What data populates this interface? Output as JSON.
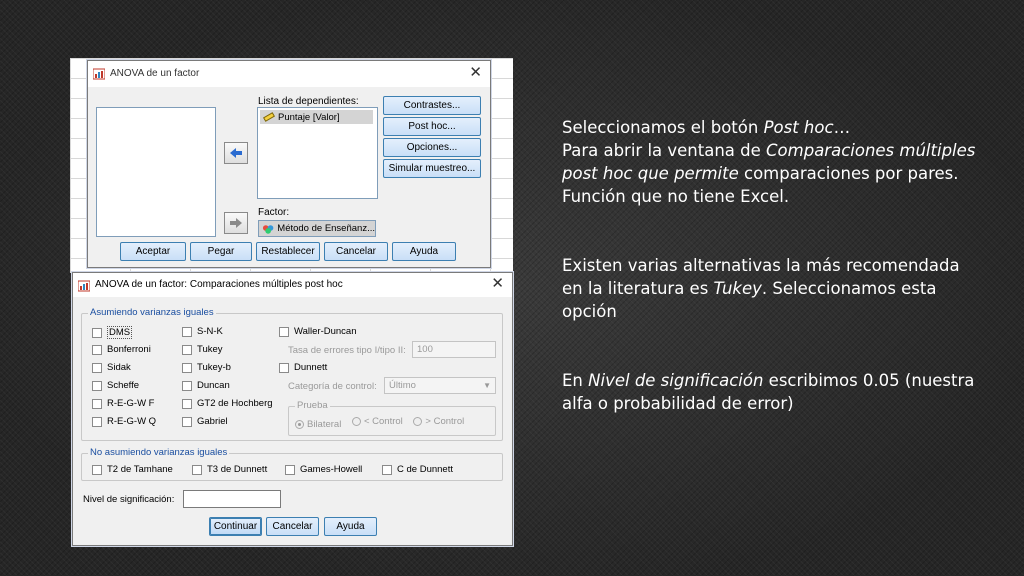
{
  "dialog1": {
    "title": "ANOVA de un factor",
    "dependents_label": "Lista de dependientes:",
    "dependent_item": "Puntaje [Valor]",
    "factor_label": "Factor:",
    "factor_item": "Método de Enseñanz...",
    "side_buttons": [
      "Contrastes...",
      "Post hoc...",
      "Opciones...",
      "Simular muestreo..."
    ],
    "bottom_buttons": [
      "Aceptar",
      "Pegar",
      "Restablecer",
      "Cancelar",
      "Ayuda"
    ]
  },
  "dialog2": {
    "title": "ANOVA de un factor: Comparaciones múltiples post hoc",
    "equal_group_title": "Asumiendo varianzas iguales",
    "col1": [
      "DMS",
      "Bonferroni",
      "Sidak",
      "Scheffe",
      "R-E-G-W F",
      "R-E-G-W Q"
    ],
    "col2": [
      "S-N-K",
      "Tukey",
      "Tukey-b",
      "Duncan",
      "GT2 de Hochberg",
      "Gabriel"
    ],
    "waller": "Waller-Duncan",
    "error_ratio_label": "Tasa de errores tipo I/tipo II:",
    "error_ratio_value": "100",
    "dunnett": "Dunnett",
    "control_category_label": "Categoría de control:",
    "control_category_value": "Último",
    "test_group_title": "Prueba",
    "test_options": [
      "Bilateral",
      "< Control",
      "> Control"
    ],
    "unequal_group_title": "No asumiendo varianzas iguales",
    "unequal_options": [
      "T2 de Tamhane",
      "T3 de Dunnett",
      "Games-Howell",
      "C de Dunnett"
    ],
    "significance_label": "Nivel de significación:",
    "significance_value": "",
    "buttons": [
      "Continuar",
      "Cancelar",
      "Ayuda"
    ]
  },
  "text": {
    "p1_a": "Seleccionamos el botón ",
    "p1_b": "Post hoc",
    "p1_c": "…",
    "p2_a": "Para abrir la ventana de  ",
    "p2_b": "Comparaciones múltiples post hoc que permite",
    "p2_c": " comparaciones por pares. Función que no tiene Excel.",
    "p3_a": "Existen varias alternativas la más recomendada en la literatura es ",
    "p3_b": "Tukey",
    "p3_c": ". Seleccionamos esta opción",
    "p4_a": "En ",
    "p4_b": "Nivel de significación",
    "p4_c": " escribimos 0.05 (nuestra alfa o probabilidad de error)"
  }
}
